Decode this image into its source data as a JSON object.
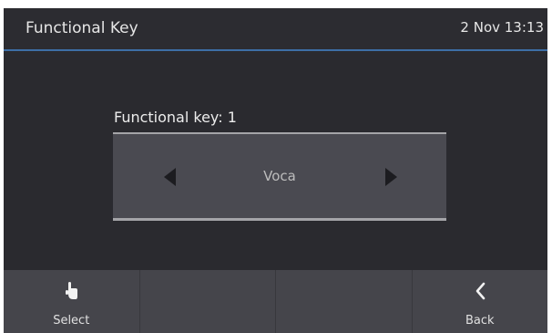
{
  "header": {
    "title": "Functional Key",
    "datetime": "2 Nov 13:13"
  },
  "main": {
    "field_label": "Functional key: 1",
    "selected_value": "Voca",
    "left_arrow_icon": "left-arrow-icon",
    "right_arrow_icon": "right-arrow-icon"
  },
  "softkeys": [
    {
      "label": "Select",
      "icon": "hand-pointer-icon"
    },
    {
      "label": "",
      "icon": ""
    },
    {
      "label": "",
      "icon": ""
    },
    {
      "label": "Back",
      "icon": "chevron-left-icon"
    }
  ],
  "colors": {
    "background": "#2a2a2f",
    "header_underline": "#3d6fa6",
    "selector_background": "#4a4a51",
    "softkey_bar": "#45454b"
  }
}
